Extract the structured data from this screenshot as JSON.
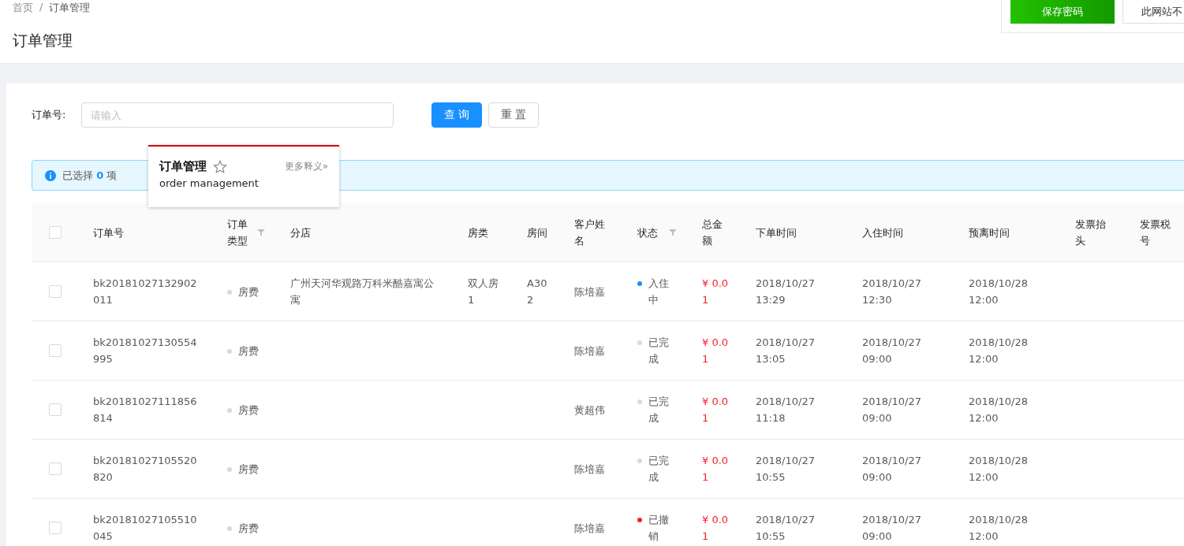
{
  "breadcrumb": [
    {
      "label": "首页",
      "selected": false
    },
    {
      "label": "订单管理",
      "selected": true
    }
  ],
  "breadcrumb_separator": "/",
  "title": "订单管理",
  "password_prompt": {
    "buttons": [
      "保存密码",
      "此网站不"
    ]
  },
  "filter": {
    "label": "订单号:",
    "placeholder": "请输入",
    "buttons": [
      "查 询",
      "重 置"
    ]
  },
  "selection_alert": {
    "before": "已选择",
    "count": "0",
    "after": "项"
  },
  "dictionary_popup": {
    "word": "订单管理",
    "more": "更多释义»",
    "translation": "order management"
  },
  "table": {
    "select_all_checked": false,
    "columns": [
      {
        "label": "订单号",
        "filter": false
      },
      {
        "label": "订单类型",
        "filter": true
      },
      {
        "label": "分店",
        "filter": false
      },
      {
        "label": "房类",
        "filter": false
      },
      {
        "label": "房间",
        "filter": false
      },
      {
        "label": "客户姓名",
        "filter": false
      },
      {
        "label": "状态",
        "filter": true
      },
      {
        "label": "总金额",
        "filter": false
      },
      {
        "label": "下单时间",
        "filter": false
      },
      {
        "label": "入住时间",
        "filter": false
      },
      {
        "label": "预离时间",
        "filter": false
      },
      {
        "label": "发票抬头",
        "filter": false
      },
      {
        "label": "发票税号",
        "filter": false
      }
    ],
    "rows": [
      {
        "checked": false,
        "order_no": "bk20181027132902011",
        "type": "房费",
        "store": "广州天河华观路万科米酷嘉寓公寓",
        "room_type": "双人房1",
        "room": "A302",
        "guest": "陈培嘉",
        "status": "入住中",
        "color": "#1890ff",
        "amount": "¥ 0.01",
        "ordered": "2018/10/27 13:29",
        "check_in": "2018/10/27 12:30",
        "check_out": "2018/10/28 12:00"
      },
      {
        "checked": false,
        "order_no": "bk20181027130554995",
        "type": "房费",
        "guest": "陈培嘉",
        "status": "已完成",
        "color": "#d9d9d9",
        "amount": "¥ 0.01",
        "ordered": "2018/10/27 13:05",
        "check_in": "2018/10/27 09:00",
        "check_out": "2018/10/28 12:00"
      },
      {
        "checked": false,
        "order_no": "bk20181027111856814",
        "type": "房费",
        "guest": "黄超伟",
        "status": "已完成",
        "color": "#d9d9d9",
        "amount": "¥ 0.01",
        "ordered": "2018/10/27 11:18",
        "check_in": "2018/10/27 09:00",
        "check_out": "2018/10/28 12:00"
      },
      {
        "checked": false,
        "order_no": "bk20181027105520820",
        "type": "房费",
        "guest": "陈培嘉",
        "status": "已完成",
        "color": "#d9d9d9",
        "amount": "¥ 0.01",
        "ordered": "2018/10/27 10:55",
        "check_in": "2018/10/27 09:00",
        "check_out": "2018/10/28 12:00"
      },
      {
        "checked": false,
        "order_no": "bk20181027105510045",
        "type": "房费",
        "guest": "陈培嘉",
        "status": "已撤销",
        "color": "#f5222d",
        "amount": "¥ 0.01",
        "ordered": "2018/10/27 10:55",
        "check_in": "2018/10/27 09:00",
        "check_out": "2018/10/28 12:00"
      }
    ]
  }
}
